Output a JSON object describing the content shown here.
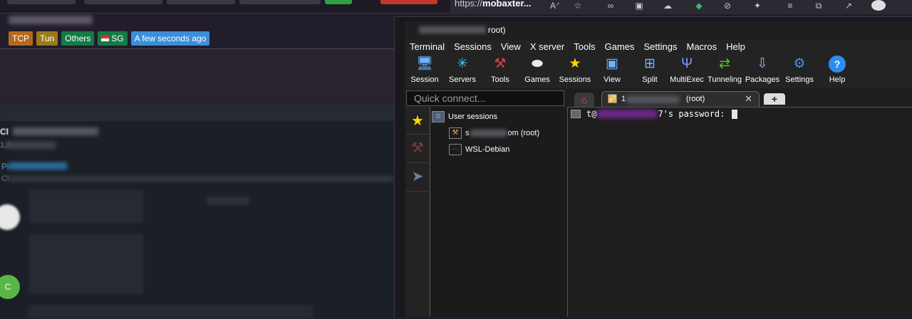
{
  "background_page": {
    "tags": [
      "TCP",
      "Tun",
      "Others",
      "SG",
      "A few seconds ago"
    ],
    "tag_colors": {
      "tcp": "#b46a1e",
      "tun": "#9a7a1a",
      "others": "#157a47",
      "sg": "#157a47",
      "time": "#3b8fd8"
    }
  },
  "chat": {
    "title_prefix": "Cl",
    "subtitle_prefix": "1,6",
    "pinned_prefix": "Pi",
    "pinned_sub_prefix": "Cl",
    "avatar_letter": "C"
  },
  "browser": {
    "url_prefix": "https://",
    "url_host": "mobaxter..."
  },
  "moba": {
    "title_suffix": "root)",
    "menu": [
      "Terminal",
      "Sessions",
      "View",
      "X server",
      "Tools",
      "Games",
      "Settings",
      "Macros",
      "Help"
    ],
    "toolbar": [
      {
        "label": "Session",
        "icon": "session-icon"
      },
      {
        "label": "Servers",
        "icon": "servers-icon"
      },
      {
        "label": "Tools",
        "icon": "tools-icon"
      },
      {
        "label": "Games",
        "icon": "games-icon"
      },
      {
        "label": "Sessions",
        "icon": "star-icon"
      },
      {
        "label": "View",
        "icon": "view-icon"
      },
      {
        "label": "Split",
        "icon": "split-icon"
      },
      {
        "label": "MultiExec",
        "icon": "multiexec-icon"
      },
      {
        "label": "Tunneling",
        "icon": "tunneling-icon"
      },
      {
        "label": "Packages",
        "icon": "packages-icon"
      },
      {
        "label": "Settings",
        "icon": "settings-icon"
      },
      {
        "label": "Help",
        "icon": "help-icon"
      }
    ],
    "quick_connect_placeholder": "Quick connect...",
    "tab": {
      "prefix": "1",
      "suffix": "(root)"
    },
    "tree": {
      "root": "User sessions",
      "session1_prefix": "s",
      "session1_suffix": "om (root)",
      "session2": "WSL-Debian"
    },
    "terminal": {
      "prefix": "t@",
      "suffix": "7's password: "
    }
  }
}
